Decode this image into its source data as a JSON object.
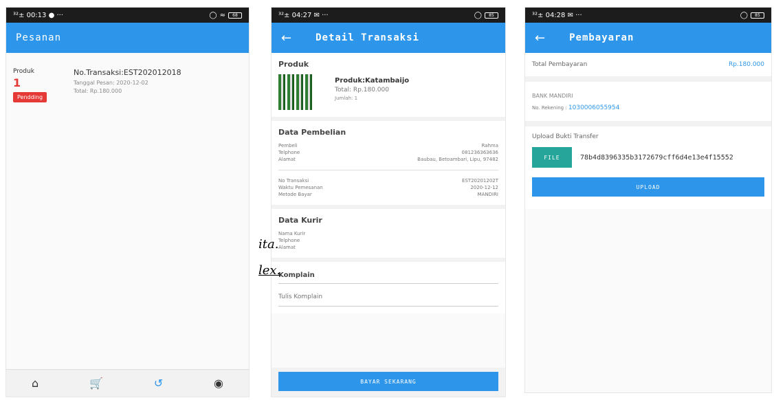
{
  "phone1": {
    "status": {
      "left": "³²± 00:13 ● ···",
      "battery": "68"
    },
    "title": "Pesanan",
    "order": {
      "produk_label": "Produk",
      "count": "1",
      "status_badge": "Pendding",
      "no_transaksi": "No.Transaksi:EST202012018",
      "tanggal": "Tanggal Pesan: 2020-12-02",
      "total": "Total: Rp.180.000"
    },
    "nav": [
      "home-icon",
      "cart-icon",
      "history-icon",
      "account-icon"
    ]
  },
  "phone2": {
    "status": {
      "left": "³²± 04:27 ✉ ···",
      "battery": "85"
    },
    "title": "Detail Transaksi",
    "produk": {
      "section": "Produk",
      "name": "Produk:Katambaijo",
      "total": "Total: Rp.180.000",
      "jumlah": "Jumlah: 1"
    },
    "pembelian": {
      "section": "Data Pembelian",
      "rows1": [
        {
          "k": "Pembeli",
          "v": "Rahma"
        },
        {
          "k": "Telphone",
          "v": "081236363636"
        },
        {
          "k": "Alamat",
          "v": "Baubau, Betoambari, Lipu, 97482"
        }
      ],
      "rows2": [
        {
          "k": "No Transaksi",
          "v": "EST20201202T"
        },
        {
          "k": "Waktu Pemesanan",
          "v": "2020-12-12"
        },
        {
          "k": "Metode Bayar",
          "v": "MANDIRI"
        }
      ]
    },
    "kurir": {
      "section": "Data Kurir",
      "rows": [
        "Nama Kurir",
        "Telphone",
        "Alamat"
      ]
    },
    "komplain": {
      "label": "Komplain",
      "placeholder": "Tulis Komplain"
    },
    "button": "BAYAR SEKARANG"
  },
  "phone3": {
    "status": {
      "left": "³²± 04:28 ✉ ···",
      "battery": "85"
    },
    "title": "Pembayaran",
    "total_label": "Total Pembayaran",
    "total_value": "Rp.180.000",
    "bank_name": "BANK MANDIRI",
    "rekening_label": "No. Rekening :",
    "rekening_value": "1030006055954",
    "upload_label": "Upload Bukti Transfer",
    "file_button": "FILE",
    "file_name": "78b4d8396335b3172679cff6d4e13e4f15552",
    "upload_button": "UPLOAD"
  },
  "overlay": {
    "frag1": "ita.",
    "frag2": "lex."
  }
}
